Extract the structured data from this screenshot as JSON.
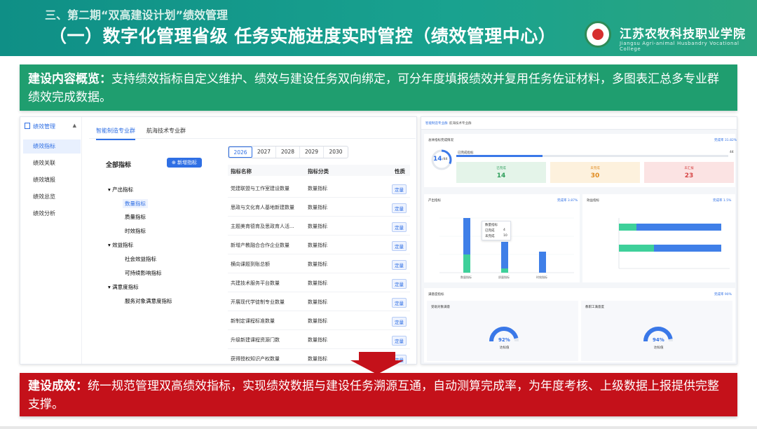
{
  "header": {
    "subtitle": "三、第二期“双高建设计划”绩效管理",
    "title": "（一）数字化管理省级 任务实施进度实时管控（绩效管理中心）",
    "college_cn": "江苏农牧科技职业学院",
    "college_en": "Jiangsu Agri-animal Husbandry Vocational College"
  },
  "overview": {
    "label": "建设内容概览：",
    "text": "支持绩效指标自定义维护、绩效与建设任务双向绑定，可分年度填报绩效并复用任务佐证材料，多图表汇总多专业群绩效完成数据。"
  },
  "result": {
    "label": "建设成效：",
    "text": "统一规范管理双高绩效指标，实现绩效数据与建设任务溯源互通，自动测算完成率，为年度考核、上级数据上报提供完整支撑。"
  },
  "panelA": {
    "nav": {
      "head": "绩效管理",
      "items": [
        "绩效指标",
        "绩效关联",
        "绩效填报",
        "绩效总览",
        "绩效分析"
      ]
    },
    "tabs": [
      "智能制造专业群",
      "航海技术专业群"
    ],
    "tree_title": "全部指标",
    "add_button": "新增指标",
    "tree": [
      {
        "label": "产出指标",
        "level": 1
      },
      {
        "label": "数量指标",
        "level": 2
      },
      {
        "label": "质量指标",
        "level": 2
      },
      {
        "label": "时效指标",
        "level": 2
      },
      {
        "label": "效益指标",
        "level": 1
      },
      {
        "label": "社会效益指标",
        "level": 2
      },
      {
        "label": "可持续影响指标",
        "level": 2
      },
      {
        "label": "满意度指标",
        "level": 1
      },
      {
        "label": "服务对象满意度指标",
        "level": 2
      }
    ],
    "years": [
      "2026",
      "2027",
      "2028",
      "2029",
      "2030"
    ],
    "table_headers": [
      "指标名称",
      "指标分类",
      "性质"
    ],
    "rows": [
      {
        "name": "党建联盟与工作室建设数量",
        "cat": "数量指标",
        "tag": "定量"
      },
      {
        "name": "思政与文化育人基地新建数量",
        "cat": "数量指标",
        "tag": "定量"
      },
      {
        "name": "主题美育德育及思政育人活...",
        "cat": "数量指标",
        "tag": "定量"
      },
      {
        "name": "新增产教融合合作企业数量",
        "cat": "数量指标",
        "tag": "定量"
      },
      {
        "name": "横向课题到账总额",
        "cat": "数量指标",
        "tag": "定量"
      },
      {
        "name": "共建技术服务平台数量",
        "cat": "数量指标",
        "tag": "定量"
      },
      {
        "name": "开展现代学徒制专业数量",
        "cat": "数量指标",
        "tag": "定量"
      },
      {
        "name": "新制定课程标准数量",
        "cat": "数量指标",
        "tag": "定量"
      },
      {
        "name": "升级新建课程资源门数",
        "cat": "数量指标",
        "tag": "定量"
      },
      {
        "name": "获得授权知识产权数量",
        "cat": "数量指标",
        "tag": "定量"
      }
    ]
  },
  "panelB": {
    "tabs": [
      "智能制造专业群",
      "航海技术专业群"
    ],
    "overview_title": "总体指标完成情况",
    "completion_link": "完成率 31.82%",
    "center_value": "14",
    "center_sub": "/44",
    "progress_label": "已完成指标",
    "progress_total": "44",
    "progress_fraction": 0.318,
    "stats": [
      {
        "label": "已完成",
        "value": "14",
        "color": "#2e9e5b",
        "bg": "#e4f4e9"
      },
      {
        "label": "未完成",
        "value": "30",
        "color": "#e08a1e",
        "bg": "#fdf1dd"
      },
      {
        "label": "未汇报",
        "value": "23",
        "color": "#d64545",
        "bg": "#fbe3e3"
      }
    ],
    "output_title": "产出指标",
    "output_link": "完成率 3.87%",
    "benefit_title": "效益指标",
    "benefit_link": "完成率 1.5%",
    "satisfaction_title": "满意度指标",
    "satisfaction_link": "完成率 90%",
    "tooltip": {
      "title": "数量指标",
      "done_label": "已完成",
      "done": "4",
      "undone_label": "未完成",
      "undone": "10"
    },
    "bar_categories": [
      "数量指标",
      "质量指标",
      "时效指标"
    ],
    "gauges": [
      {
        "title": "受助对象满意",
        "value": "92%",
        "fraction": 0.92,
        "sub": "达标值"
      },
      {
        "title": "教职工满意度",
        "value": "94%",
        "fraction": 0.94,
        "sub": "达标值"
      }
    ]
  },
  "colors": {
    "header": "#0f8f86",
    "green_band": "#1f9e6f",
    "red_band": "#c4111a",
    "accent": "#2f6fe4"
  }
}
